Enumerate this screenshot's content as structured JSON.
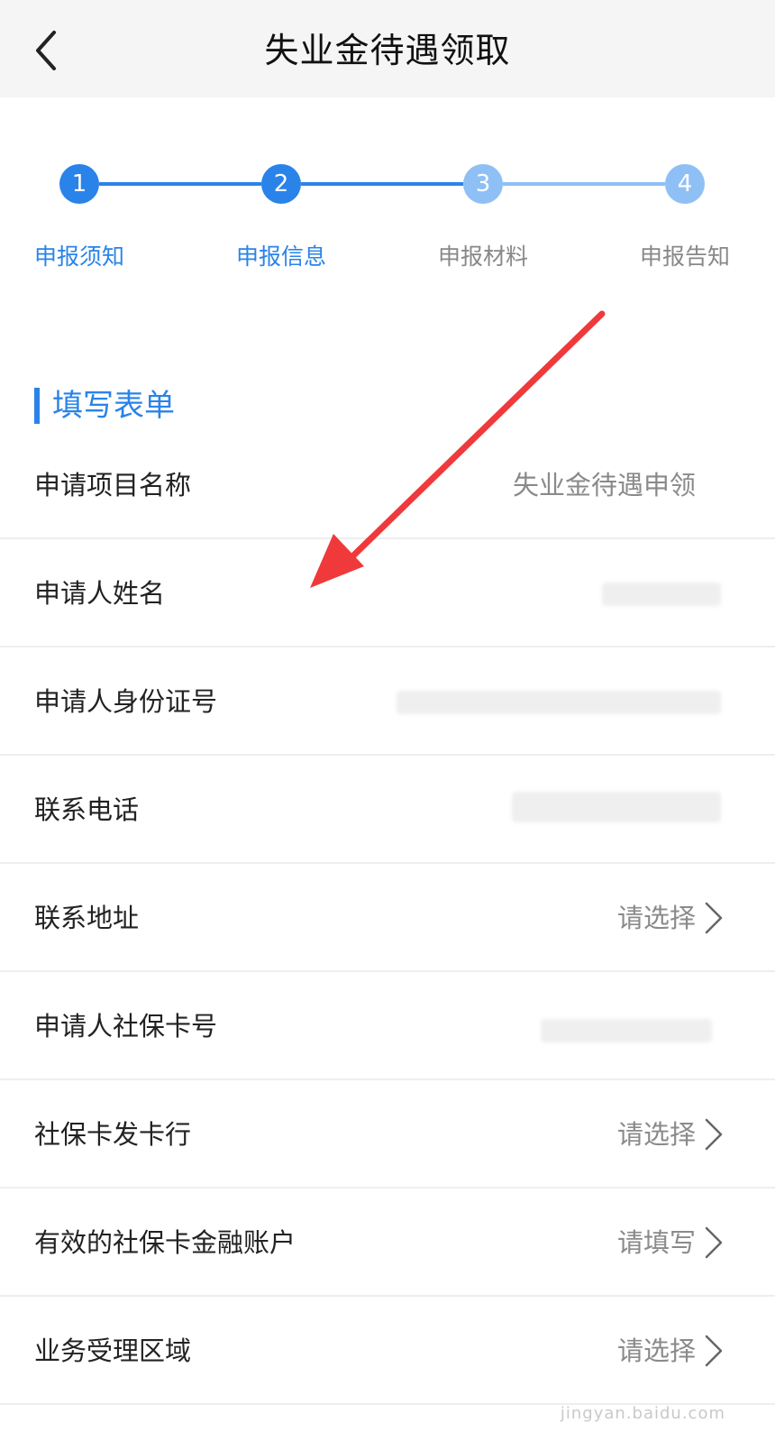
{
  "header": {
    "title": "失业金待遇领取",
    "back_icon": "chevron-left-icon"
  },
  "steps": [
    {
      "number": "1",
      "label": "申报须知",
      "state": "done"
    },
    {
      "number": "2",
      "label": "申报信息",
      "state": "active"
    },
    {
      "number": "3",
      "label": "申报材料",
      "state": "pending"
    },
    {
      "number": "4",
      "label": "申报告知",
      "state": "pending"
    }
  ],
  "colors": {
    "accent": "#2a83e8",
    "pending": "#8fc0f5",
    "arrow": "#f0393b"
  },
  "section": {
    "title": "填写表单"
  },
  "form": {
    "rows": [
      {
        "label": "申请项目名称",
        "value": "失业金待遇申领",
        "type": "text"
      },
      {
        "label": "申请人姓名",
        "value": "",
        "type": "blurred"
      },
      {
        "label": "申请人身份证号",
        "value": "",
        "type": "blurred"
      },
      {
        "label": "联系电话",
        "value": "",
        "type": "blurred"
      },
      {
        "label": "联系地址",
        "value": "请选择",
        "type": "select"
      },
      {
        "label": "申请人社保卡号",
        "value": "",
        "type": "blurred"
      },
      {
        "label": "社保卡发卡行",
        "value": "请选择",
        "type": "select"
      },
      {
        "label": "有效的社保卡金融账户",
        "value": "请填写",
        "type": "select"
      },
      {
        "label": "业务受理区域",
        "value": "请选择",
        "type": "select"
      }
    ]
  },
  "watermark": "jingyan.baidu.com"
}
